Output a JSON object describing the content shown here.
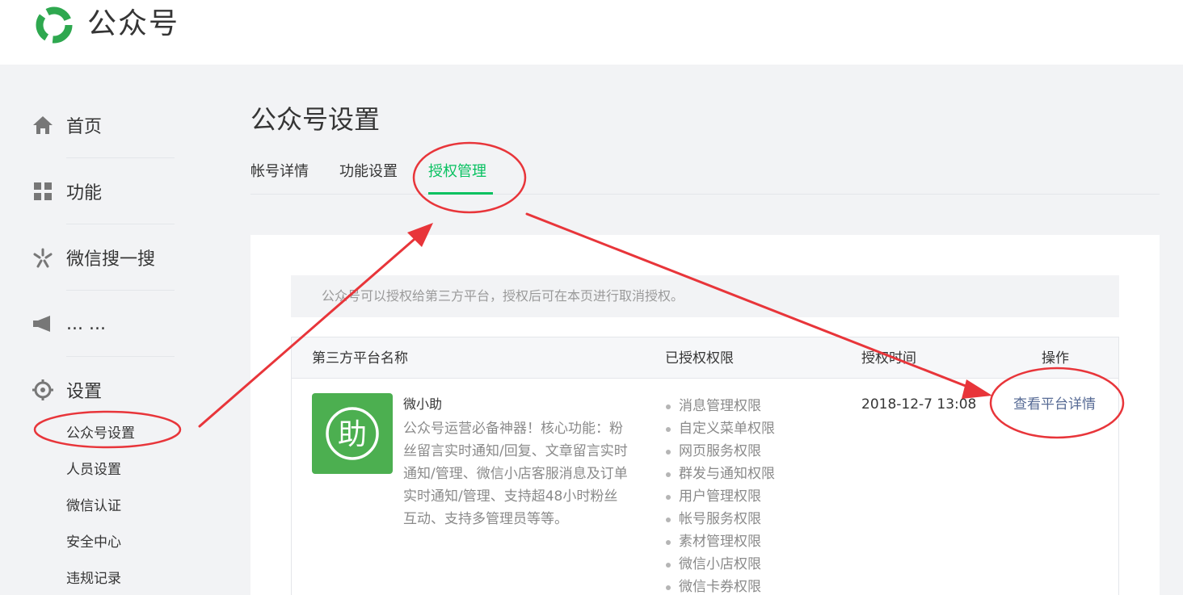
{
  "header": {
    "title": "公众号"
  },
  "sidebar": {
    "items": [
      {
        "label": "首页",
        "icon": "home-icon"
      },
      {
        "label": "功能",
        "icon": "grid-icon"
      },
      {
        "label": "微信搜一搜",
        "icon": "sousou-icon"
      },
      {
        "label": "... ...",
        "icon": "megaphone-icon"
      },
      {
        "label": "设置",
        "icon": "gear-icon"
      }
    ],
    "sub_items": [
      "公众号设置",
      "人员设置",
      "微信认证",
      "安全中心",
      "违规记录"
    ]
  },
  "main": {
    "title": "公众号设置",
    "tabs": [
      "帐号详情",
      "功能设置",
      "授权管理"
    ],
    "active_tab": "授权管理",
    "notice": "公众号可以授权给第三方平台，授权后可在本页进行取消授权。",
    "table": {
      "headers": [
        "第三方平台名称",
        "已授权权限",
        "授权时间",
        "操作"
      ],
      "rows": [
        {
          "icon_char": "助",
          "name": "微小助",
          "description": "公众号运营必备神器！核心功能：粉丝留言实时通知/回复、文章留言实时通知/管理、微信小店客服消息及订单实时通知/管理、支持超48小时粉丝互动、支持多管理员等等。",
          "permissions": [
            "消息管理权限",
            "自定义菜单权限",
            "网页服务权限",
            "群发与通知权限",
            "用户管理权限",
            "帐号服务权限",
            "素材管理权限",
            "微信小店权限",
            "微信卡券权限"
          ],
          "auth_time": "2018-12-7 13:08",
          "action": "查看平台详情"
        }
      ]
    }
  },
  "colors": {
    "accent": "#07c160",
    "link": "#576b95",
    "annotation": "#e8353a",
    "app_icon_bg": "#4caf50"
  }
}
